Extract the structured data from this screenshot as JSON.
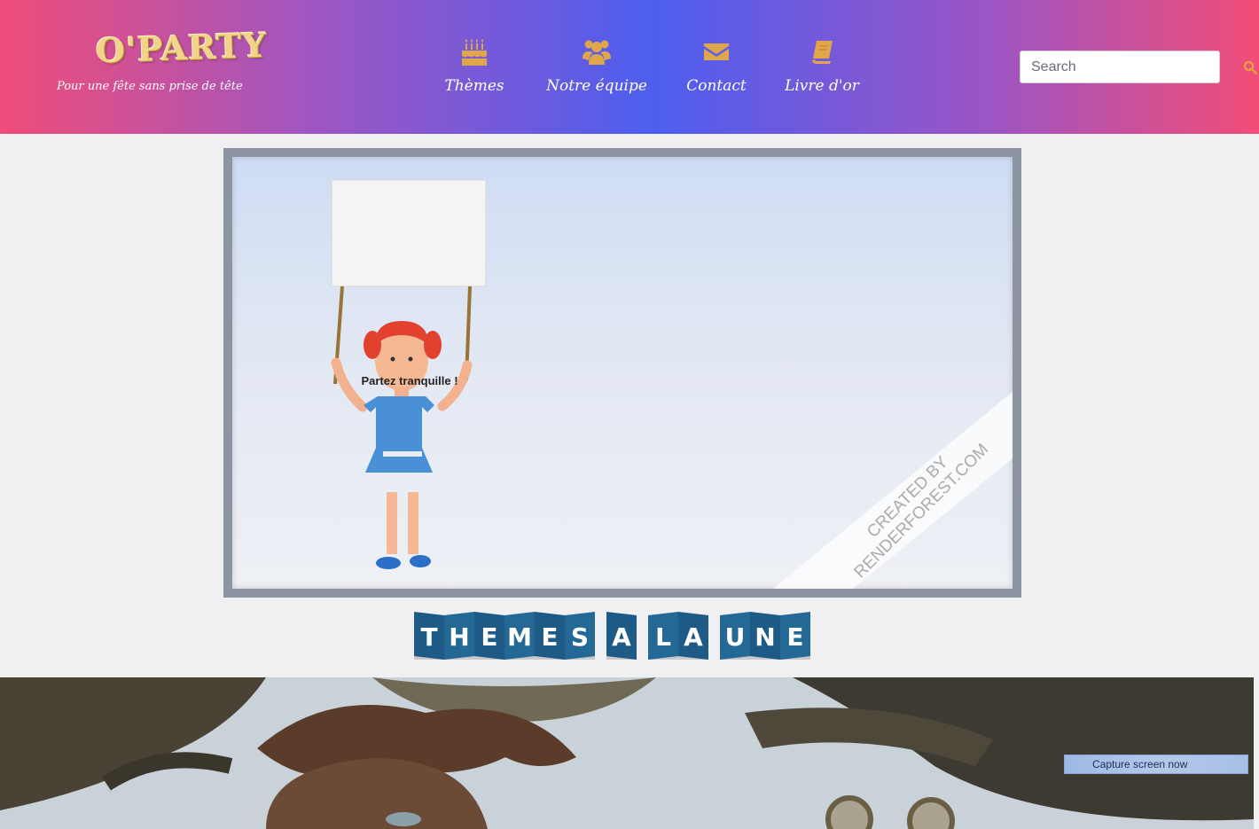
{
  "brand": {
    "logo": "O'PARTY",
    "tagline": "Pour une fête sans prise de tête"
  },
  "nav": [
    {
      "label": "Thèmes",
      "icon": "birthday-cake-icon"
    },
    {
      "label": "Notre équipe",
      "icon": "users-icon"
    },
    {
      "label": "Contact",
      "icon": "envelope-icon"
    },
    {
      "label": "Livre d'or",
      "icon": "book-icon"
    }
  ],
  "search": {
    "placeholder": "Search",
    "value": ""
  },
  "hero": {
    "sign_text": "Partez tranquille !",
    "watermark_line1": "CREATED BY",
    "watermark_line2": "RENDERFOREST.COM"
  },
  "themes_banner": {
    "words": [
      "THEMES",
      "A",
      "LA",
      "UNE"
    ]
  },
  "capture_button": {
    "label": "Capture screen now"
  },
  "colors": {
    "nav_icon": "#e0a74a",
    "banner_tile": "#1d5a86",
    "search_icon": "#e4a23b"
  }
}
